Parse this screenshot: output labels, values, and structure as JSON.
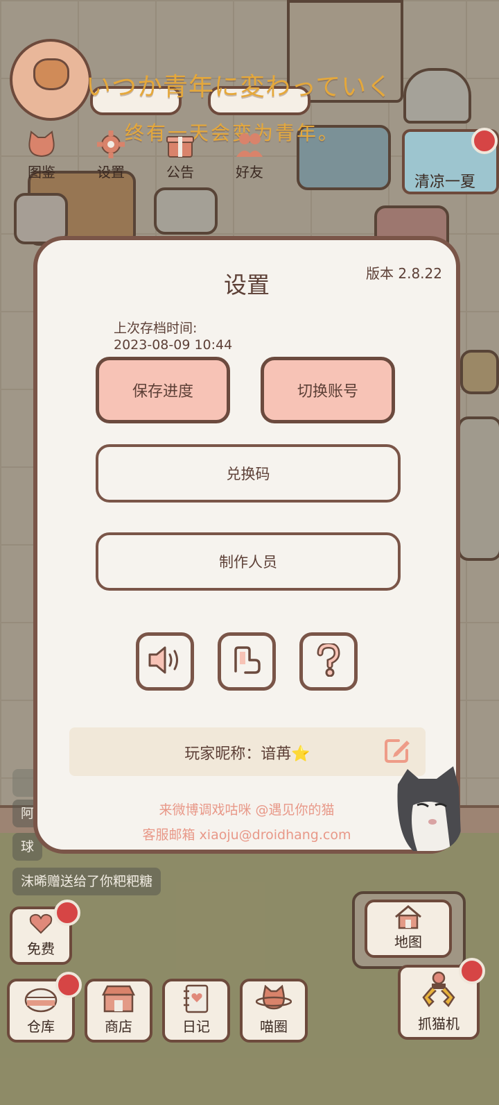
{
  "colors": {
    "dialog_bg": "#f6f3ee",
    "dialog_border": "#7a5548",
    "pink_button": "#f7c3b6",
    "text_brown": "#5d4037",
    "footer_pink": "#e89888",
    "slogan_gold": "#e5a83b",
    "badge_red": "#d64545"
  },
  "top_bar": {
    "slogan_jp": "いつか青年に変わっていく",
    "slogan_zh": "终有一天会变为青年。",
    "menu": [
      {
        "label": "图鉴",
        "icon": "cat-head-icon"
      },
      {
        "label": "设置",
        "icon": "gear-icon"
      },
      {
        "label": "公告",
        "icon": "gift-icon"
      },
      {
        "label": "好友",
        "icon": "friends-icon"
      }
    ],
    "event_label": "清凉一夏"
  },
  "settings": {
    "title": "设置",
    "version": "版本 2.8.22",
    "save_label": "上次存档时间:",
    "save_time": "2023-08-09 10:44",
    "save_button": "保存进度",
    "switch_button": "切换账号",
    "redeem_button": "兑换码",
    "credits_button": "制作人员",
    "icons": [
      "speaker-icon",
      "music-note-icon",
      "help-icon"
    ],
    "nickname": "玩家昵称：谙苒⭐",
    "weibo": "来微博调戏咕咪 @遇见你的猫",
    "email": "客服邮箱 xiaoju@droidhang.com"
  },
  "chat": {
    "line1": "阿",
    "line2": "球",
    "line3": "沫晞赠送给了你粑粑糖"
  },
  "bottom_bar": {
    "free": "免费",
    "warehouse": "仓库",
    "shop": "商店",
    "diary": "日记",
    "circle": "喵圈",
    "map": "地图",
    "claw": "抓猫机"
  }
}
